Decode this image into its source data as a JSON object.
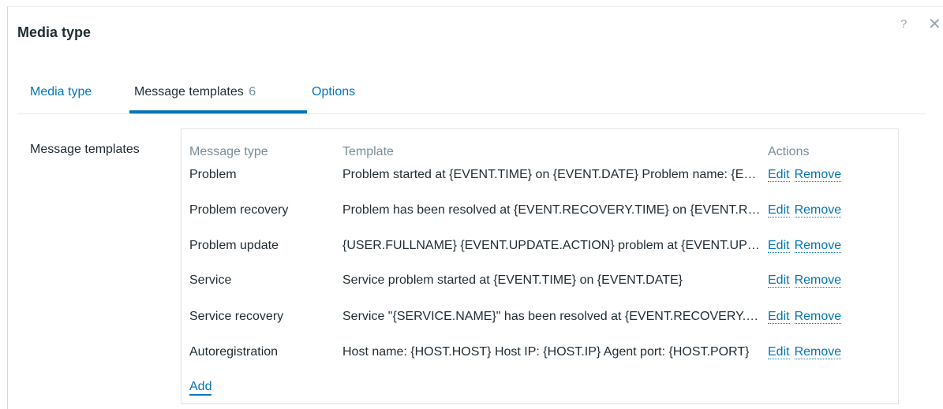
{
  "dialog": {
    "title": "Media type",
    "help_icon": "?",
    "close_icon": "✕"
  },
  "tabs": [
    {
      "label": "Media type",
      "count": ""
    },
    {
      "label": "Message templates",
      "count": "6"
    },
    {
      "label": "Options",
      "count": ""
    }
  ],
  "form": {
    "label": "Message templates"
  },
  "table": {
    "headers": {
      "type": "Message type",
      "template": "Template",
      "actions": "Actions"
    },
    "rows": [
      {
        "type": "Problem",
        "template": "Problem started at {EVENT.TIME} on {EVENT.DATE} Problem name: {EVENT.NAME}",
        "edit": "Edit",
        "remove": "Remove"
      },
      {
        "type": "Problem recovery",
        "template": "Problem has been resolved at {EVENT.RECOVERY.TIME} on {EVENT.RECOVERY.DATE}",
        "edit": "Edit",
        "remove": "Remove"
      },
      {
        "type": "Problem update",
        "template": "{USER.FULLNAME} {EVENT.UPDATE.ACTION} problem at {EVENT.UPDATE.DATE}",
        "edit": "Edit",
        "remove": "Remove"
      },
      {
        "type": "Service",
        "template": "Service problem started at {EVENT.TIME} on {EVENT.DATE}",
        "edit": "Edit",
        "remove": "Remove"
      },
      {
        "type": "Service recovery",
        "template": "Service \"{SERVICE.NAME}\" has been resolved at {EVENT.RECOVERY.TIME}",
        "edit": "Edit",
        "remove": "Remove"
      },
      {
        "type": "Autoregistration",
        "template": "Host name: {HOST.HOST} Host IP: {HOST.IP} Agent port: {HOST.PORT}",
        "edit": "Edit",
        "remove": "Remove"
      }
    ],
    "add_label": "Add"
  }
}
